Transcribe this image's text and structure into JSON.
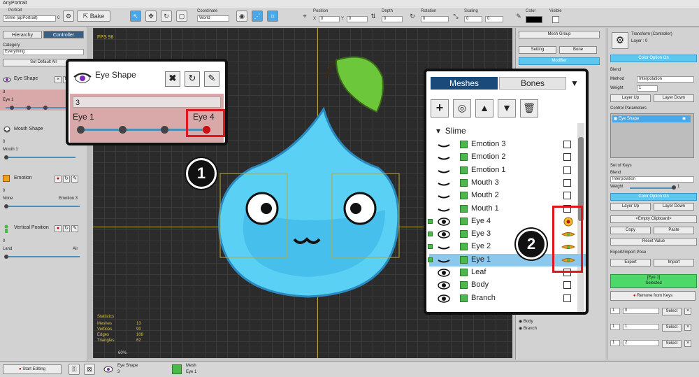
{
  "app": {
    "title": "AnyPortrait"
  },
  "toolbar": {
    "portrait_label": "Portrait",
    "portrait_value": "Slime (apPortrait)",
    "portrait_count": "0",
    "bake_label": "Bake",
    "coordinate_label": "Coordinate",
    "coordinate_value": "World",
    "position_label": "Position",
    "x_label": "X",
    "x_value": "0",
    "y_label": "Y",
    "y_value": "0",
    "depth_label": "Depth",
    "depth_value": "0",
    "rotation_label": "Rotation",
    "rotation_value": "0",
    "scaling_label": "Scaling",
    "scaling_x": "0",
    "scaling_y": "0",
    "color_label": "Color",
    "visible_label": "Visible"
  },
  "left": {
    "tabs": [
      "Hierarchy",
      "Controller"
    ],
    "category_label": "Category",
    "category_value": "Everything",
    "set_default_label": "Set Default All",
    "controls": [
      {
        "name": "Eye Shape",
        "value": "3",
        "left": "Eye 1",
        "right": ""
      },
      {
        "name": "Mouth Shape",
        "value": "0",
        "left": "Mouth 1",
        "right": ""
      },
      {
        "name": "Emotion",
        "value": "0",
        "left": "None",
        "right": "Emotion 3"
      },
      {
        "name": "Vertical Position",
        "value": "0",
        "left": "Land",
        "right": "Air"
      }
    ]
  },
  "viewport": {
    "fps": "FPS 98",
    "stats_title": "Statistics",
    "stats": [
      {
        "k": "Meshes",
        "v": "13"
      },
      {
        "k": "Vertices",
        "v": "90"
      },
      {
        "k": "Edges",
        "v": "108"
      },
      {
        "k": "Triangles",
        "v": "62"
      }
    ],
    "zoom": "60%"
  },
  "callout1": {
    "title": "Eye Shape",
    "value": "3",
    "left_label": "Eye 1",
    "right_label": "Eye 4",
    "number": "1"
  },
  "callout2": {
    "tab_meshes": "Meshes",
    "tab_bones": "Bones",
    "root": "Slime",
    "number": "2",
    "rows": [
      "Emotion 3",
      "Emotion 2",
      "Emotion 1",
      "Mouth 3",
      "Mouth 2",
      "Mouth 1",
      "Eye 4",
      "Eye 3",
      "Eye 2",
      "Eye 1",
      "Leaf",
      "Body",
      "Branch"
    ]
  },
  "meshgroup": {
    "header": "Mesh Group",
    "setting": "Setting",
    "bone": "Bone",
    "modifier": "Modifier",
    "bottom_rows": [
      "Body",
      "Branch"
    ]
  },
  "inspector": {
    "title": "Transform (Controller)",
    "layer": "Layer : 0",
    "color_option_on": "Color Option On",
    "blend_label": "Blend",
    "method_label": "Method",
    "method_value": "Interpolation",
    "weight_label": "Weight",
    "weight_value": "1",
    "layer_up": "Layer Up",
    "layer_down": "Layer Down",
    "control_params_label": "Control Parameters",
    "control_param_item": "Eye Shape",
    "set_of_keys_label": "Set of Keys",
    "blend2_label": "Blend",
    "blend2_value": "Interpolation",
    "weight2_label": "Weight",
    "weight2_value": "1",
    "color_option_on2": "Color Option On",
    "layer_up2": "Layer Up",
    "layer_down2": "Layer Down",
    "clipboard": "<Empty Clipboard>",
    "copy": "Copy",
    "paste": "Paste",
    "reset_value": "Reset Value",
    "export_import_label": "Export/Import Pose",
    "export": "Export",
    "import": "Import",
    "selected_name": "[Eye 1]",
    "selected_label": "Selected",
    "remove_keys": "Remove from Keys",
    "keys": [
      {
        "idx": "1",
        "val": "0",
        "btn": "Select"
      },
      {
        "idx": "1",
        "val": "1",
        "btn": "Select"
      },
      {
        "idx": "1",
        "val": "2",
        "btn": "Select"
      }
    ]
  },
  "bottom": {
    "start_editing": "Start Editing",
    "param_name": "Eye Shape",
    "param_value": "3",
    "mesh_label": "Mesh",
    "mesh_value": "Eye 1"
  },
  "colors": {
    "accent": "#4aa8e8",
    "highlight_red": "#e0161d",
    "mesh_green": "#4ab84a",
    "panel": "#d2d2d2"
  }
}
